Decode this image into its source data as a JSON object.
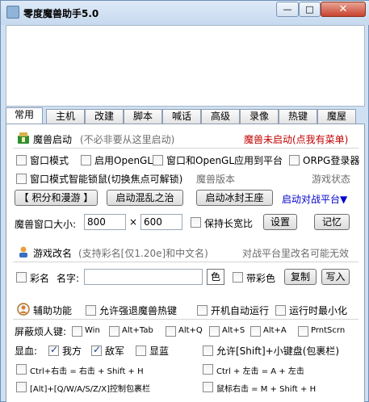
{
  "window": {
    "title": "零度魔兽助手5.0",
    "minimize": "—",
    "maximize": "□",
    "close": "✕"
  },
  "tabs": [
    "常用",
    "主机",
    "改建",
    "脚本",
    "喊话",
    "高级",
    "录像",
    "热键",
    "魔屋"
  ],
  "launch": {
    "label": "魔兽启动",
    "hint": "(不必非要从这里启动)",
    "status": "魔兽未启动(点我有菜单)",
    "window_mode": "窗口模式",
    "opengl": "启用OpenGL",
    "window_opengl_platform": "窗口和OpenGL应用到平台",
    "orpg_login": "ORPG登录器",
    "smart_mouse_lock": "窗口模式智能锁鼠(切换焦点可解锁)",
    "war3_version_label": "魔兽版本",
    "game_status_label": "游戏状态",
    "points_button": "【 积分和漫游 】",
    "start_chaos_button": "启动混乱之治",
    "start_frozen_button": "启动冰封王座",
    "start_platform_link": "启动对战平台▼"
  },
  "window_size": {
    "label": "魔兽窗口大小:",
    "width": "800",
    "times": "×",
    "height": "600",
    "keep_ratio": "保持长宽比",
    "settings_button": "设置",
    "remember_button": "记忆"
  },
  "rename": {
    "label": "游戏改名",
    "hint": "(支持彩名[仅1.20e]和中文名)",
    "platform_note": "对战平台里改名可能无效",
    "color_name": "彩名",
    "name_label": "名字:",
    "name_value": "",
    "color_button": "色",
    "with_color": "带彩色",
    "copy_button": "复制",
    "write_button": "写入"
  },
  "aux": {
    "label": "辅助功能",
    "allow_force_hotkey": "允许强退魔兽热键",
    "auto_run": "开机自动运行",
    "min_on_run": "运行时最小化",
    "block_keys_label": "屏蔽烦人键:",
    "keys": [
      "Win",
      "Alt+Tab",
      "Alt+Q",
      "Alt+S",
      "Alt+A",
      "PrntScrn"
    ],
    "hp_label": "显血:",
    "hp_self": "我方",
    "hp_enemy": "敌军",
    "hp_blue": "显蓝",
    "allow_shift_keypad": "允许[Shift]+小键盘(包裹栏)",
    "ctrl_right_click": "Ctrl+右击 = 右击 + Shift + H",
    "ctrl_left_click": "Ctrl + 左击 = A + 左击",
    "alt_inventory": "[Alt]+[Q/W/A/S/Z/X]控制包裹栏",
    "mouse_right": "鼠标右击 = M + Shift + H"
  },
  "colors": {
    "status_red": "#c00000",
    "link_blue": "#0000cc",
    "hint_gray": "#6d6d6d"
  }
}
